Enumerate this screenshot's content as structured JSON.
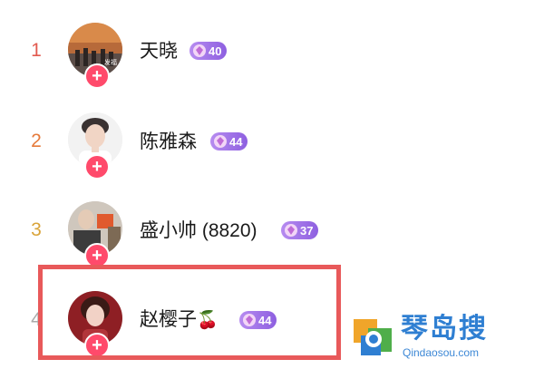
{
  "list": {
    "rows": [
      {
        "rank": "1",
        "name": "天晓",
        "level": "40",
        "rank_color": "#e25a4f"
      },
      {
        "rank": "2",
        "name": "陈雅森",
        "level": "44",
        "rank_color": "#e67a3b"
      },
      {
        "rank": "3",
        "name": "盛小帅 (8820)",
        "level": "37",
        "rank_color": "#d9a43a"
      },
      {
        "rank": "4",
        "name": "赵樱子",
        "name_emoji": "🍒",
        "level": "44",
        "rank_color": "#aaaaaa"
      }
    ],
    "follow_label": "+",
    "avatar1_text": "发福"
  },
  "colors": {
    "highlight": "#e8595a",
    "badge": "#9b6ae6",
    "follow": "#ff4a6b"
  },
  "watermark": {
    "title": "琴岛搜",
    "url": "Qindaosou.com"
  }
}
